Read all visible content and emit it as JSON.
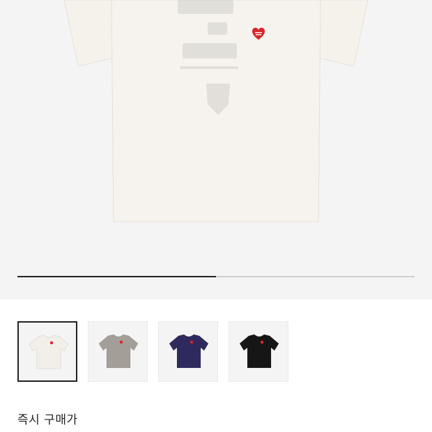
{
  "product": {
    "hero_image": {
      "icon": "t-shirt-front-icon",
      "shirt_color": "#f5f2ec",
      "accent_color": "#d8262c"
    },
    "carousel": {
      "progress_fraction": 0.5
    },
    "variants": [
      {
        "name": "white",
        "color": "#f2efe9",
        "selected": true
      },
      {
        "name": "gray",
        "color": "#a39f98",
        "selected": false
      },
      {
        "name": "navy",
        "color": "#2e2a5e",
        "selected": false
      },
      {
        "name": "black",
        "color": "#161616",
        "selected": false
      }
    ],
    "instant_buy_label": "즉시 구매가"
  }
}
